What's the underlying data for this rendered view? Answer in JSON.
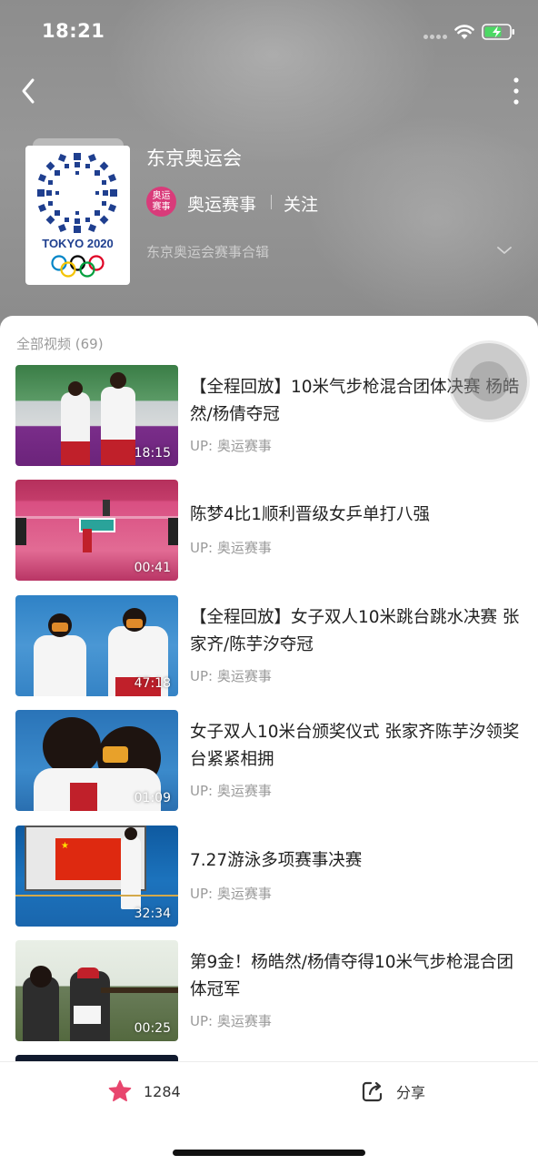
{
  "status_bar": {
    "time": "18:21"
  },
  "header": {
    "playlist_title": "东京奥运会",
    "channel_avatar_text": "奥运\n赛事",
    "channel_name": "奥运赛事",
    "follow_label": "关注",
    "description": "东京奥运会赛事合辑",
    "cover_text": "TOKYO 2020"
  },
  "list": {
    "count_label": "全部视频 (69)",
    "items": [
      {
        "title": "【全程回放】10米气步枪混合团体决赛 杨皓然/杨倩夺冠",
        "uploader": "UP: 奥运赛事",
        "duration": "18:15"
      },
      {
        "title": "陈梦4比1顺利晋级女乒单打八强",
        "uploader": "UP: 奥运赛事",
        "duration": "00:41"
      },
      {
        "title": "【全程回放】女子双人10米跳台跳水决赛 张家齐/陈芋汐夺冠",
        "uploader": "UP: 奥运赛事",
        "duration": "47:18"
      },
      {
        "title": "女子双人10米台颁奖仪式 张家齐陈芋汐领奖台紧紧相拥",
        "uploader": "UP: 奥运赛事",
        "duration": "01:09"
      },
      {
        "title": "7.27游泳多项赛事决赛",
        "uploader": "UP: 奥运赛事",
        "duration": "32:34"
      },
      {
        "title": "第9金！杨皓然/杨倩夺得10米气步枪混合团体冠军",
        "uploader": "UP: 奥运赛事",
        "duration": "00:25"
      }
    ]
  },
  "bottom_bar": {
    "fav_count": "1284",
    "share_label": "分享"
  },
  "colors": {
    "accent": "#e8466e",
    "avatar_bg": "#d93b7a",
    "olympic_blue": "#1f3f8f"
  }
}
